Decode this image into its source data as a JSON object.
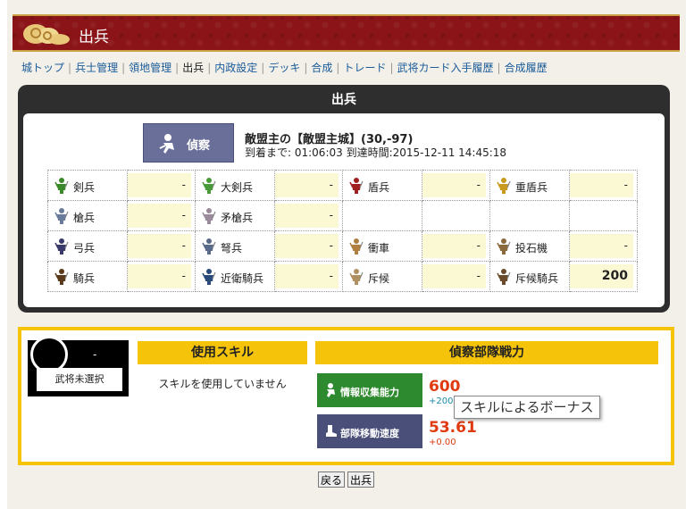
{
  "header": {
    "title": "出兵"
  },
  "tabs": [
    {
      "label": "城トップ",
      "current": false
    },
    {
      "label": "兵士管理",
      "current": false
    },
    {
      "label": "領地管理",
      "current": false
    },
    {
      "label": "出兵",
      "current": true
    },
    {
      "label": "内政設定",
      "current": false
    },
    {
      "label": "デッキ",
      "current": false
    },
    {
      "label": "合成",
      "current": false
    },
    {
      "label": "トレード",
      "current": false
    },
    {
      "label": "武将カード入手履歴",
      "current": false
    },
    {
      "label": "合成履歴",
      "current": false
    }
  ],
  "panel": {
    "title": "出兵",
    "mode_button": "偵察",
    "target": "敵盟主の【敵盟主城】(30,-97)",
    "eta": "到着まで: 01:06:03 到達時間:2015-12-11 14:45:18"
  },
  "units": [
    [
      {
        "name": "剣兵",
        "value": "-",
        "color": "#3a8a2a"
      },
      {
        "name": "大剣兵",
        "value": "-",
        "color": "#4a9a3a"
      },
      {
        "name": "盾兵",
        "value": "-",
        "color": "#a02020"
      },
      {
        "name": "重盾兵",
        "value": "-",
        "color": "#c89a20"
      }
    ],
    [
      {
        "name": "槍兵",
        "value": "-",
        "color": "#6a7a9a"
      },
      {
        "name": "矛槍兵",
        "value": "-",
        "color": "#9a8a9a"
      },
      null,
      null
    ],
    [
      {
        "name": "弓兵",
        "value": "-",
        "color": "#3a3a6a"
      },
      {
        "name": "弩兵",
        "value": "-",
        "color": "#5a6a8a"
      },
      {
        "name": "衝車",
        "value": "-",
        "color": "#b08040"
      },
      {
        "name": "投石機",
        "value": "-",
        "color": "#8a6a3a"
      }
    ],
    [
      {
        "name": "騎兵",
        "value": "-",
        "color": "#5a3a1a"
      },
      {
        "name": "近衛騎兵",
        "value": "-",
        "color": "#2a4a7a"
      },
      {
        "name": "斥候",
        "value": "-",
        "color": "#b09060"
      },
      {
        "name": "斥候騎兵",
        "value": "200",
        "color": "#6a4a2a"
      }
    ]
  ],
  "general": {
    "dash": "-",
    "label": "武将未選択"
  },
  "skills": {
    "header": "使用スキル",
    "none_text": "スキルを使用していません"
  },
  "power": {
    "header": "偵察部隊戦力",
    "intel": {
      "label": "情報収集能力",
      "value": "600",
      "bonus": "+200",
      "color": "#2e8a2e"
    },
    "speed": {
      "label": "部隊移動速度",
      "value": "53.61",
      "bonus": "+0.00",
      "color": "#4a4f7a"
    }
  },
  "tooltip": "スキルによるボーナス",
  "buttons": {
    "back": "戻る",
    "send": "出兵"
  }
}
